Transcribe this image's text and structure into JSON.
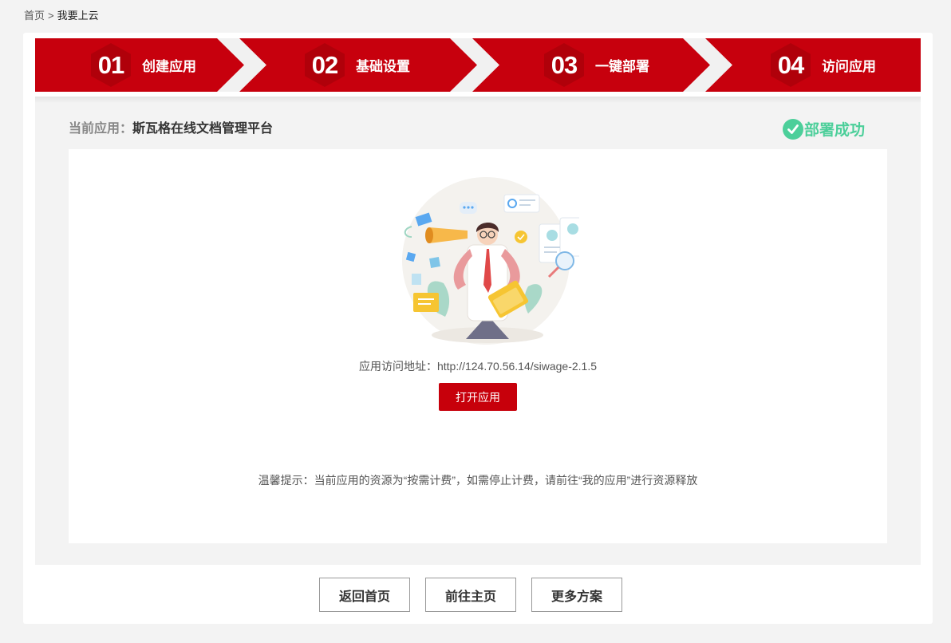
{
  "breadcrumb": {
    "home": "首页",
    "separator": ">",
    "current": "我要上云"
  },
  "steps": [
    {
      "number": "01",
      "label": "创建应用"
    },
    {
      "number": "02",
      "label": "基础设置"
    },
    {
      "number": "03",
      "label": "一键部署"
    },
    {
      "number": "04",
      "label": "访问应用"
    }
  ],
  "app": {
    "label": "当前应用：",
    "name": "斯瓦格在线文档管理平台"
  },
  "status": {
    "text": "部署成功",
    "icon": "check-circle-icon"
  },
  "access": {
    "label": "应用访问地址：",
    "url": "http://124.70.56.14/siwage-2.1.5"
  },
  "open_button": "打开应用",
  "tip": "温馨提示：当前应用的资源为“按需计费”，如需停止计费，请前往“我的应用”进行资源释放",
  "buttons": {
    "home": "返回首页",
    "main": "前往主页",
    "more": "更多方案"
  },
  "colors": {
    "accent": "#c7000b",
    "success": "#4ccf9a",
    "background": "#f3f3f3"
  }
}
